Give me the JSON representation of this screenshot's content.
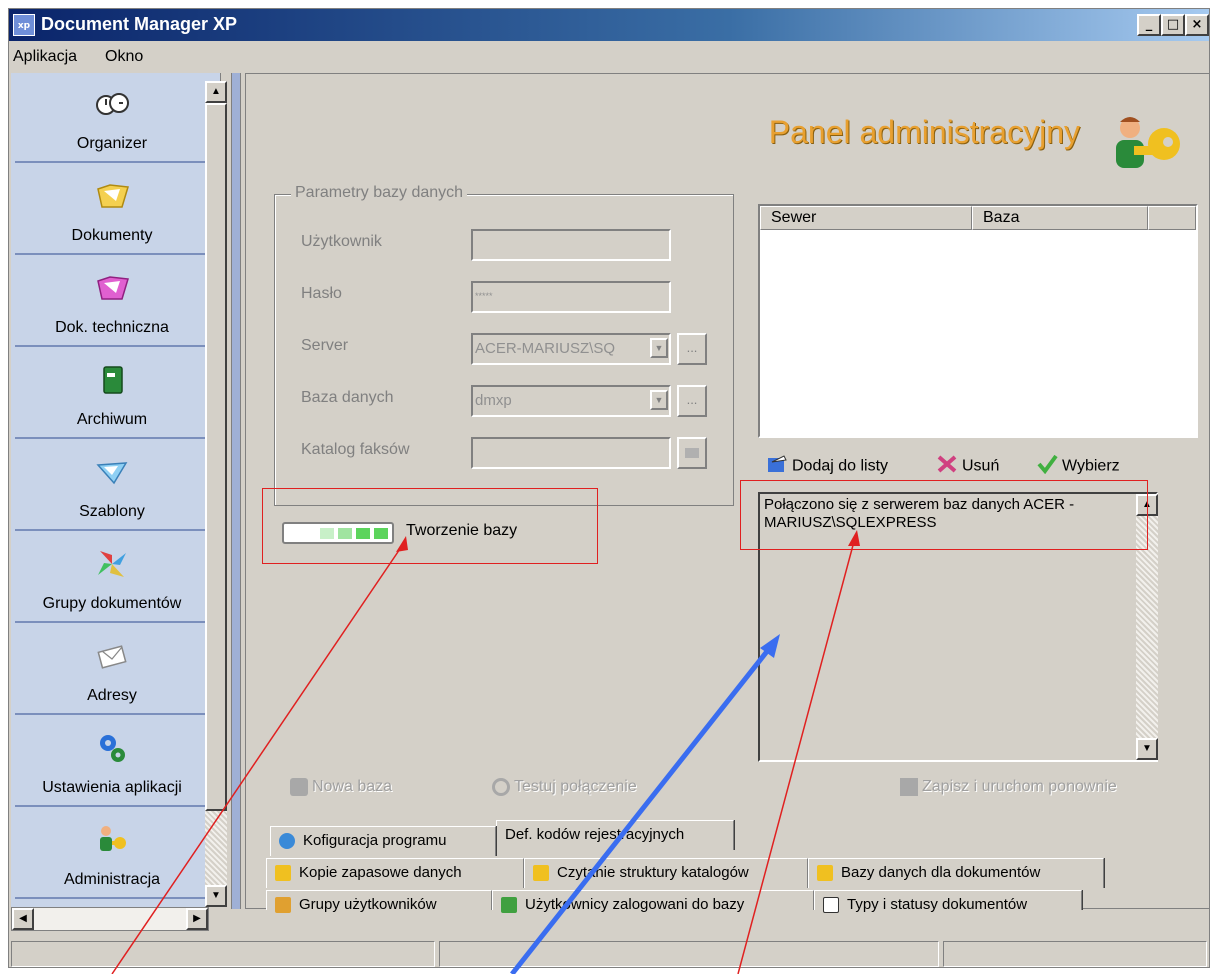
{
  "window": {
    "title": "Document Manager XP",
    "icon_label": "xp",
    "controls": {
      "minimize": "_",
      "maximize": "□",
      "close": "×"
    }
  },
  "menu": [
    "Aplikacja",
    "Okno"
  ],
  "sidebar": {
    "items": [
      {
        "label": "Organizer",
        "icon": "clock-icon"
      },
      {
        "label": "Dokumenty",
        "icon": "folder-icon"
      },
      {
        "label": "Dok. techniczna",
        "icon": "folder-technical-icon"
      },
      {
        "label": "Archiwum",
        "icon": "book-icon"
      },
      {
        "label": "Szablony",
        "icon": "template-icon"
      },
      {
        "label": "Grupy dokumentów",
        "icon": "pinwheel-icon"
      },
      {
        "label": "Adresy",
        "icon": "envelope-icon"
      },
      {
        "label": "Ustawienia aplikacji",
        "icon": "gears-icon"
      },
      {
        "label": "Administracja",
        "icon": "admin-key-icon"
      }
    ]
  },
  "panel": {
    "title": "Panel administracyjny",
    "db_params": {
      "legend": "Parametry bazy danych",
      "user_label": "Użytkownik",
      "user_value": "",
      "password_label": "Hasło",
      "password_value": "*****",
      "server_label": "Server",
      "server_value": "ACER-MARIUSZ\\SQ",
      "database_label": "Baza danych",
      "database_value": "dmxp",
      "fax_label": "Katalog faksów",
      "fax_value": "",
      "browse": "..."
    },
    "progress": {
      "label": "Tworzenie bazy",
      "fraction": 0.6
    },
    "server_list": {
      "columns": [
        "Sewer",
        "Baza",
        ""
      ],
      "rows": []
    },
    "list_actions": {
      "add": "Dodaj do listy",
      "remove": "Usuń",
      "select": "Wybierz"
    },
    "log_text": "Połączono się z serwerem baz danych ACER -MARIUSZ\\SQLEXPRESS",
    "actions": {
      "new_db": "Nowa baza",
      "test": "Testuj połączenie",
      "save_restart": "Zapisz i uruchom ponownie"
    }
  },
  "tabs": [
    [
      "Kofiguracja programu",
      "Def. kodów rejestracyjnych"
    ],
    [
      "Kopie zapasowe danych",
      "Czytanie struktury katalogów",
      "Bazy danych dla dokumentów"
    ],
    [
      "Grupy użytkowników",
      "Użytkownicy zalogowani do bazy",
      "Typy i statusy dokumentów"
    ]
  ],
  "colors": {
    "accent_title": "#e8a030",
    "annotation_red": "#e02020",
    "annotation_blue": "#3a6df0",
    "progress_green": "#5cd45c"
  }
}
